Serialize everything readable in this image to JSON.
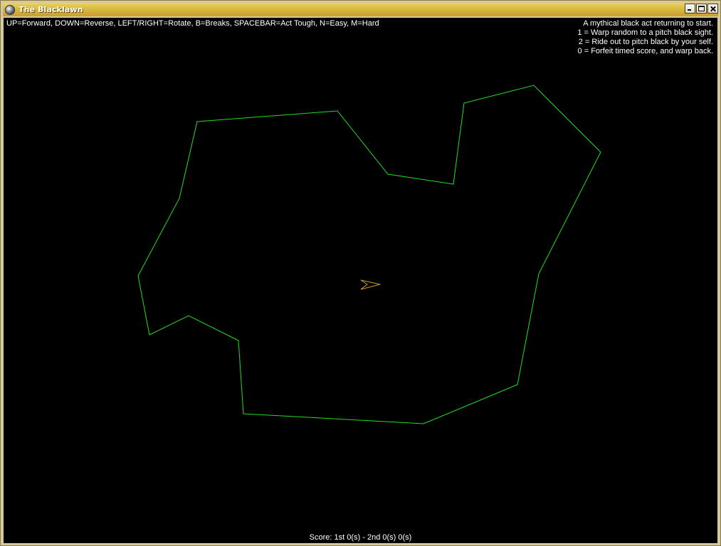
{
  "window": {
    "title": "The Blacklawn",
    "icon": "globe-icon",
    "buttons": [
      "minimize-icon",
      "maximize-icon",
      "close-icon"
    ]
  },
  "hud": {
    "controls": "UP=Forward, DOWN=Reverse, LEFT/RIGHT=Rotate, B=Breaks, SPACEBAR=Act Tough, N=Easy, M=Hard",
    "hints": [
      "A mythical black act returning to start.",
      "1 = Warp random to a pitch black sight.",
      "2 = Ride out to pitch black by your self.",
      "0 = Forfeit timed score, and warp back."
    ],
    "score": "Score: 1st 0(s) - 2nd 0(s) 0(s)"
  },
  "colors": {
    "lawn_outline": "#22dd22",
    "ship": "#c8a028",
    "background": "#000000",
    "text": "#ffffff"
  }
}
